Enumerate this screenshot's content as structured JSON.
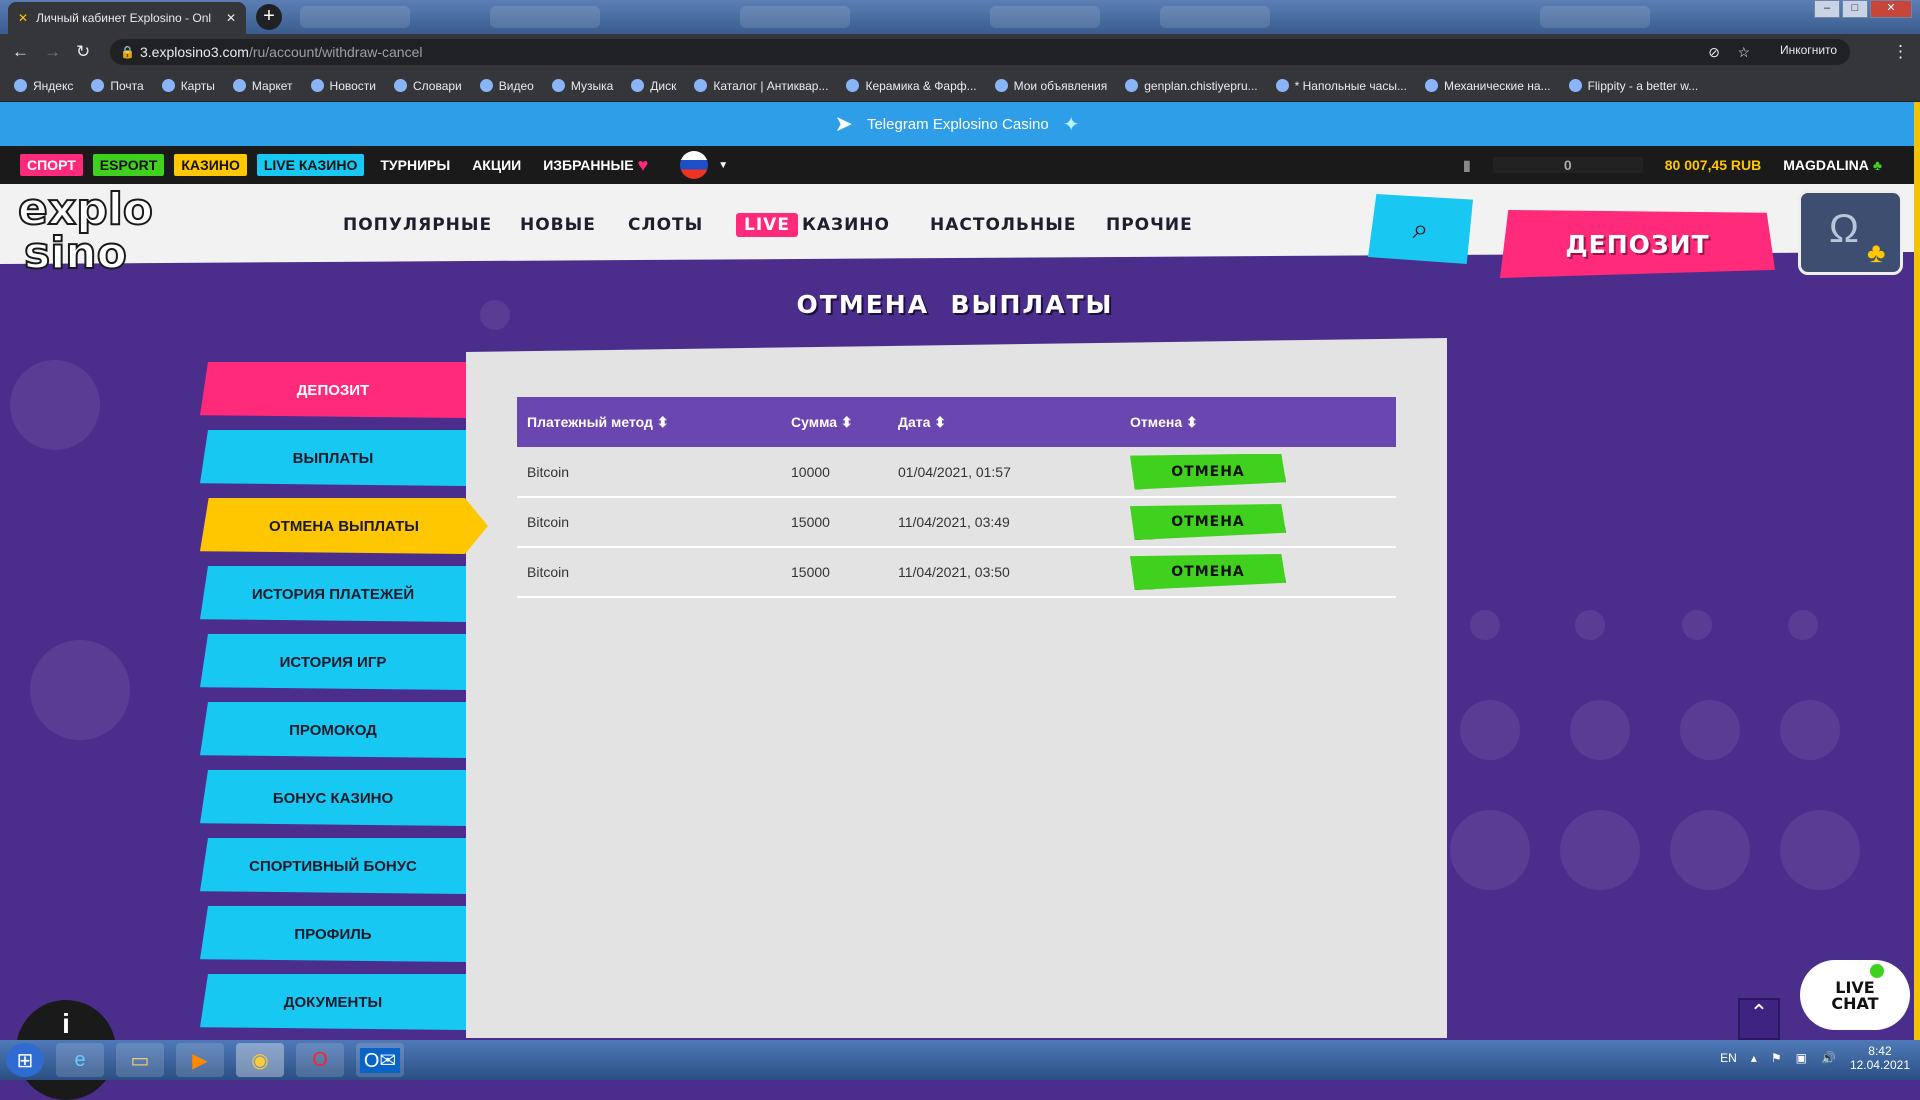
{
  "browser": {
    "tab_title": "Личный кабинет Explosino - Onl",
    "url_host": "3.explosino3.com",
    "url_path": "/ru/account/withdraw-cancel",
    "incognito_label": "Инкогнито",
    "bookmarks": [
      "Яндекс",
      "Почта",
      "Карты",
      "Маркет",
      "Новости",
      "Словари",
      "Видео",
      "Музыка",
      "Диск",
      "Каталог | Антиквар...",
      "Керамика & Фарф...",
      "Мои объявления",
      "genplan.chistiyepru...",
      "* Напольные часы...",
      "Механические на...",
      "Flippity - a better w..."
    ]
  },
  "telegram": {
    "label": "Telegram Explosino Casino"
  },
  "topnav": {
    "pills": [
      {
        "label": "СПОРТ",
        "color": "#ff2a7a"
      },
      {
        "label": "ESPORT",
        "color": "#3fd11e"
      },
      {
        "label": "КАЗИНО",
        "color": "#ffc700"
      },
      {
        "label": "LIVE КАЗИНО",
        "color": "#17c9f2"
      }
    ],
    "links": [
      "ТУРНИРЫ",
      "АКЦИИ",
      "ИЗБРАННЫЕ"
    ],
    "counter": "0",
    "balance": "80 007,45 RUB",
    "username": "MAGDALINA"
  },
  "mainnav": {
    "items": [
      "ПОПУЛЯРНЫЕ",
      "НОВЫЕ",
      "СЛОТЫ",
      "КАЗИНО",
      "НАСТОЛЬНЫЕ",
      "ПРОЧИЕ"
    ],
    "live_badge": "LIVE",
    "deposit_label": "ДЕПОЗИТ"
  },
  "logo": {
    "line1": "explo",
    "line2": "sino"
  },
  "page_title": "ОТМЕНА  ВЫПЛАТЫ",
  "sidebar": [
    {
      "label": "ДЕПОЗИТ",
      "style": "pink"
    },
    {
      "label": "ВЫПЛАТЫ",
      "style": "cyan"
    },
    {
      "label": "ОТМЕНА ВЫПЛАТЫ",
      "style": "yellow"
    },
    {
      "label": "ИСТОРИЯ ПЛАТЕЖЕЙ",
      "style": "cyan"
    },
    {
      "label": "ИСТОРИЯ ИГР",
      "style": "cyan"
    },
    {
      "label": "ПРОМОКОД",
      "style": "cyan"
    },
    {
      "label": "БОНУС КАЗИНО",
      "style": "cyan"
    },
    {
      "label": "СПОРТИВНЫЙ БОНУС",
      "style": "cyan"
    },
    {
      "label": "ПРОФИЛЬ",
      "style": "cyan"
    },
    {
      "label": "ДОКУМЕНТЫ",
      "style": "cyan"
    }
  ],
  "table": {
    "headers": [
      "Платежный метод",
      "Сумма",
      "Дата",
      "Отмена"
    ],
    "rows": [
      {
        "method": "Bitcoin",
        "amount": "10000",
        "date": "01/04/2021, 01:57",
        "action": "ОТМЕНА"
      },
      {
        "method": "Bitcoin",
        "amount": "15000",
        "date": "11/04/2021, 03:49",
        "action": "ОТМЕНА"
      },
      {
        "method": "Bitcoin",
        "amount": "15000",
        "date": "11/04/2021, 03:50",
        "action": "ОТМЕНА"
      }
    ]
  },
  "livechat": {
    "line1": "LIVE",
    "line2": "CHAT"
  },
  "taskbar": {
    "lang": "EN",
    "time": "8:42",
    "date": "12.04.2021"
  }
}
